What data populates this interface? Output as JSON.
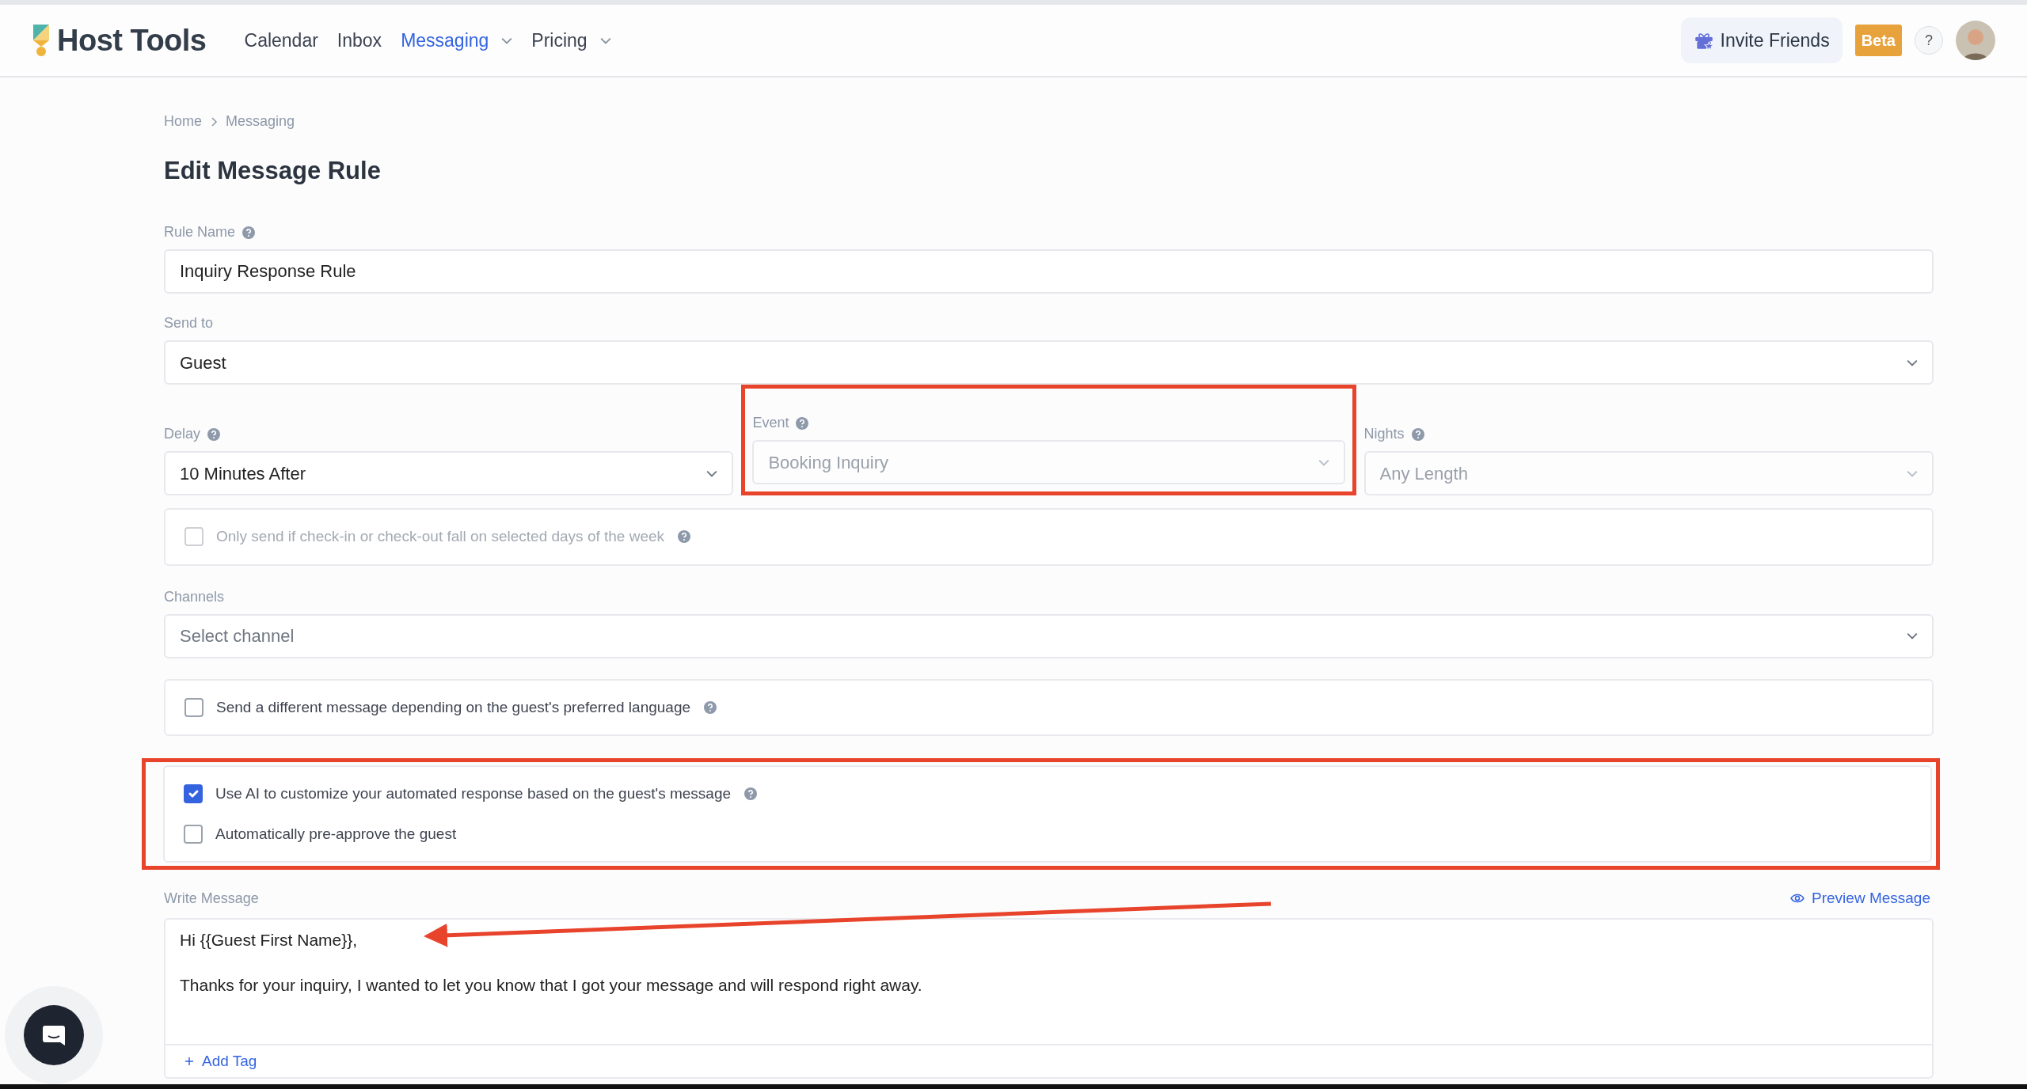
{
  "navbar": {
    "brand": "Host Tools",
    "links": [
      {
        "label": "Calendar",
        "selected": false,
        "dropdown": false
      },
      {
        "label": "Inbox",
        "selected": false,
        "dropdown": false
      },
      {
        "label": "Messaging",
        "selected": true,
        "dropdown": true
      },
      {
        "label": "Pricing",
        "selected": false,
        "dropdown": true
      }
    ],
    "invite_button": "Invite Friends",
    "beta_badge": "Beta",
    "help_button": "?"
  },
  "breadcrumb": [
    "Home",
    "Messaging"
  ],
  "title": "Edit Message Rule",
  "rule_name": {
    "label": "Rule Name",
    "value": "Inquiry Response Rule"
  },
  "send_to": {
    "label": "Send to",
    "value": "Guest"
  },
  "delay": {
    "label": "Delay",
    "value": "10 Minutes After",
    "disabled": false
  },
  "event": {
    "label": "Event",
    "value": "Booking Inquiry",
    "disabled": true,
    "highlighted": true
  },
  "nights": {
    "label": "Nights",
    "value": "Any Length",
    "disabled": true
  },
  "days_option": {
    "label": "Only send if check-in or check-out fall on selected days of the week",
    "checked": false,
    "disabled": true
  },
  "channels": {
    "label": "Channels",
    "placeholder": "Select channel"
  },
  "language_option": {
    "label": "Send a different message depending on the guest's preferred language",
    "checked": false,
    "disabled": false
  },
  "ai_options": {
    "highlighted": true,
    "items": [
      {
        "label": "Use AI to customize your automated response based on the guest's message",
        "checked": true,
        "help": true
      },
      {
        "label": "Automatically pre-approve the guest",
        "checked": false,
        "help": false
      }
    ]
  },
  "message": {
    "label": "Write Message",
    "preview_link": "Preview Message",
    "lines": [
      "Hi {{Guest First Name}},",
      "Thanks for your inquiry, I wanted to let you know that I got your message and will respond right away."
    ],
    "add_tag": "Add Tag",
    "arrow_annotation": true
  }
}
